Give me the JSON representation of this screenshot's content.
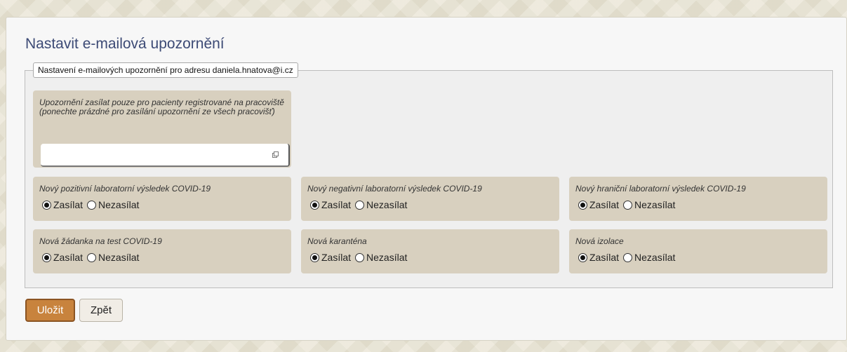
{
  "page": {
    "title": "Nastavit e-mailová upozornění",
    "legend": "Nastavení e-mailových upozornění pro adresu daniela.hnatova@i.cz"
  },
  "registered_filter": {
    "label_line1": "Upozornění zasílat pouze pro pacienty registrované na pracoviště",
    "label_line2": "(ponechte prázdné pro zasílání upozornění ze všech pracovišť)",
    "value": ""
  },
  "options": {
    "send": "Zasílat",
    "no_send": "Nezasílat"
  },
  "settings": [
    {
      "label": "Nový pozitivní laboratorní výsledek COVID-19",
      "selected": "Zasílat"
    },
    {
      "label": "Nový negativní laboratorní výsledek COVID-19",
      "selected": "Zasílat"
    },
    {
      "label": "Nový hraniční laboratorní výsledek COVID-19",
      "selected": "Zasílat"
    },
    {
      "label": "Nová žádanka na test COVID-19",
      "selected": "Zasílat"
    },
    {
      "label": "Nová karanténa",
      "selected": "Zasílat"
    },
    {
      "label": "Nová izolace",
      "selected": "Zasílat"
    }
  ],
  "actions": {
    "save": "Uložit",
    "back": "Zpět"
  },
  "icons": {
    "popup": "popup-window-icon"
  },
  "colors": {
    "title": "#3c4a75",
    "box": "#d8d0bf",
    "save_button": "#c8833d"
  }
}
